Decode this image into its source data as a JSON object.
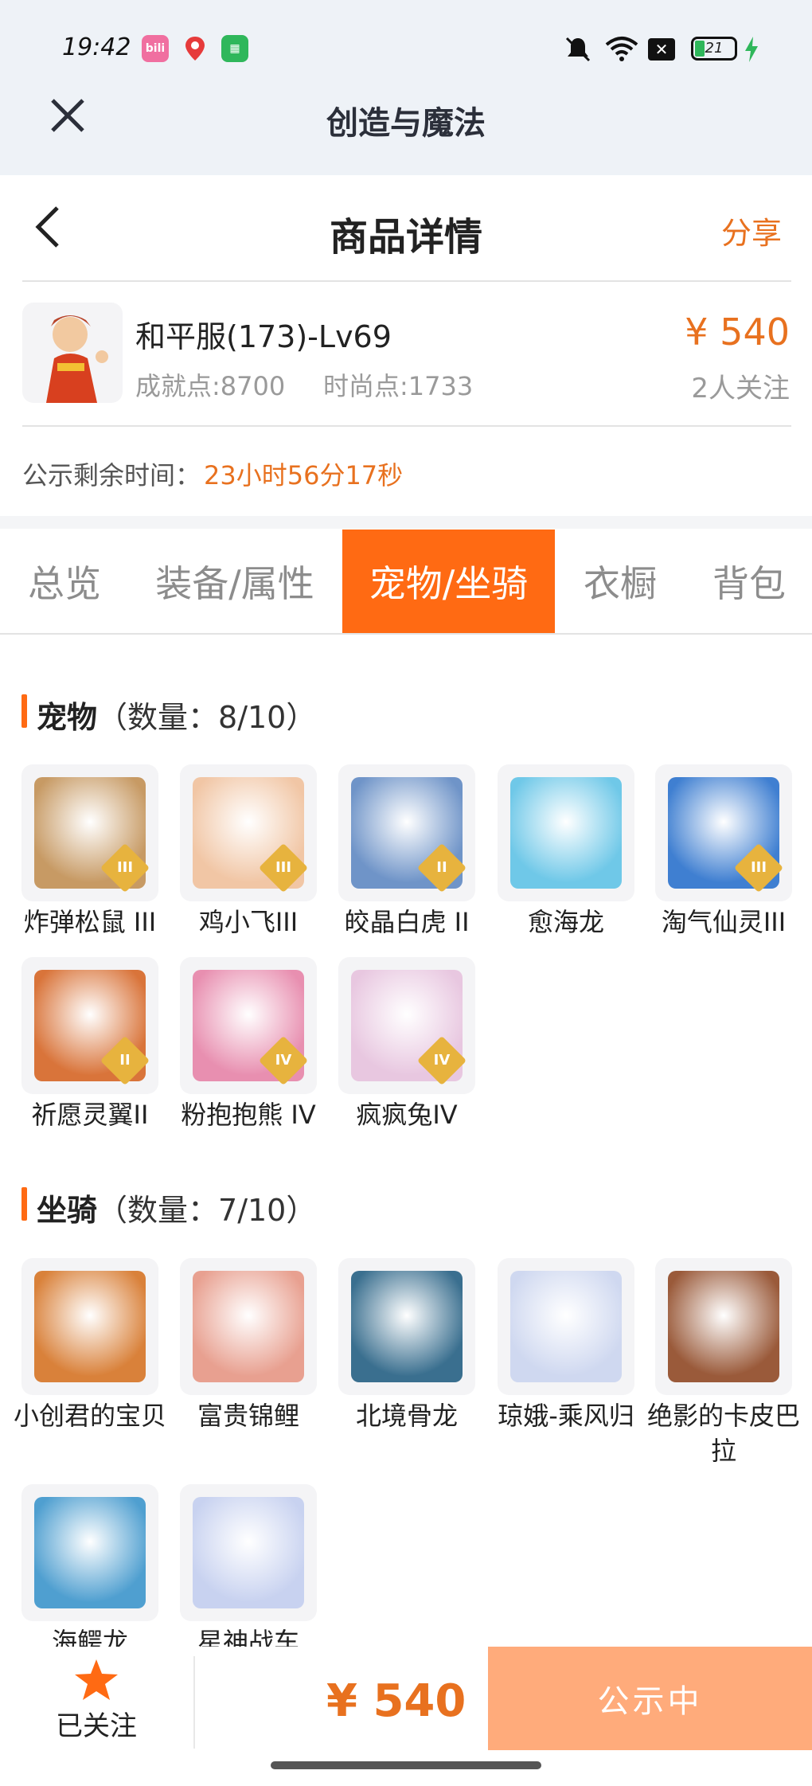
{
  "status_bar": {
    "time": "19:42",
    "battery": "21"
  },
  "app": {
    "title": "创造与魔法"
  },
  "header": {
    "title": "商品详情",
    "share_label": "分享"
  },
  "product": {
    "name": "和平服(173)-Lv69",
    "achievement": "成就点:8700",
    "fashion": "时尚点:1733",
    "price": "¥ 540",
    "followers": "2人关注"
  },
  "countdown": {
    "label": "公示剩余时间：",
    "value": "23小时56分17秒"
  },
  "tabs": [
    "总览",
    "装备/属性",
    "宠物/坐骑",
    "衣橱",
    "背包"
  ],
  "pets": {
    "title": "宠物",
    "count": "（数量：8/10）",
    "items": [
      {
        "name": "炸弹松鼠 III",
        "badge": "III",
        "color": "#c79a64"
      },
      {
        "name": "鸡小飞III",
        "badge": "III",
        "color": "#f1c6a5"
      },
      {
        "name": "皎晶白虎 II",
        "badge": "II",
        "color": "#6f94c8"
      },
      {
        "name": "愈海龙",
        "badge": "",
        "color": "#6fc8e8"
      },
      {
        "name": "淘气仙灵III",
        "badge": "III",
        "color": "#3f7fd1"
      },
      {
        "name": "祈愿灵翼II",
        "badge": "II",
        "color": "#d9743a"
      },
      {
        "name": "粉抱抱熊 IV",
        "badge": "IV",
        "color": "#e88fb0"
      },
      {
        "name": "疯疯兔IV",
        "badge": "IV",
        "color": "#e8c7e0"
      }
    ]
  },
  "mounts": {
    "title": "坐骑",
    "count": "（数量：7/10）",
    "items": [
      {
        "name": "小创君的宝贝",
        "color": "#d9813a"
      },
      {
        "name": "富贵锦鲤",
        "color": "#e8a090"
      },
      {
        "name": "北境骨龙",
        "color": "#3a6f8f"
      },
      {
        "name": "琼娥-乘风归",
        "color": "#cfd8f0"
      },
      {
        "name": "绝影的卡皮巴拉",
        "color": "#9a5a3a"
      },
      {
        "name": "海鳄龙",
        "color": "#4f9fd0"
      },
      {
        "name": "星神战车",
        "color": "#c8d2f0"
      }
    ]
  },
  "bottom": {
    "follow_label": "已关注",
    "price": "¥ 540",
    "action_label": "公示中"
  },
  "colors": {
    "accent": "#ff6a13",
    "accent_text": "#e8711f",
    "action_bg": "#ffab7b"
  }
}
